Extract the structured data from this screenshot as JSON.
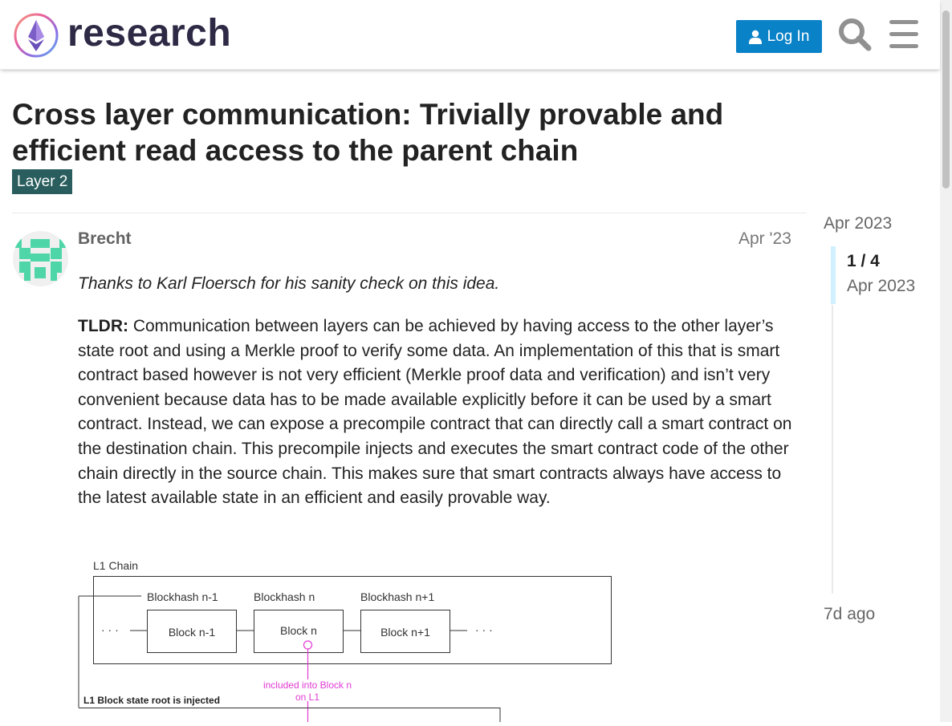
{
  "header": {
    "brand": "research",
    "login_label": "Log In",
    "search_icon": "search-icon",
    "menu_icon": "hamburger-menu-icon",
    "accent_color": "#0a82c8"
  },
  "topic": {
    "title": "Cross layer communication: Trivially provable and efficient read access to the parent chain",
    "category": "Layer 2",
    "category_color": "#2a5e5e"
  },
  "post": {
    "author": "Brecht",
    "date": "Apr '23",
    "thanks": "Thanks to Karl Floersch for his sanity check on this idea.",
    "tldr_label": "TLDR:",
    "tldr_text": " Communication between layers can be achieved by having access to the other layer’s state root and using a Merkle proof to verify some data. An implementation of this that is smart contract based however is not very efficient (Merkle proof data and verification) and isn’t very convenient because data has to be made available explicitly before it can be used by a smart contract. Instead, we can expose a precompile contract that can directly call a smart contract on the destination chain. This precompile injects and executes the smart contract code of the other chain directly in the source chain. This makes sure that smart contracts always have access to the latest available state in an efficient and easily provable way."
  },
  "diagram": {
    "chain_label": "L1 Chain",
    "hash_labels": [
      "Blockhash n-1",
      "Blockhash n",
      "Blockhash n+1"
    ],
    "block_labels": [
      "Block n-1",
      "Block n",
      "Block n+1"
    ],
    "ellipsis": "· · ·",
    "included_line1": "included into Block n",
    "included_line2": "on L1",
    "state_root_label": "L1 Block state root is injected"
  },
  "timeline": {
    "top_date": "Apr 2023",
    "position": "1 / 4",
    "position_date": "Apr 2023",
    "bottom_date": "7d ago"
  }
}
